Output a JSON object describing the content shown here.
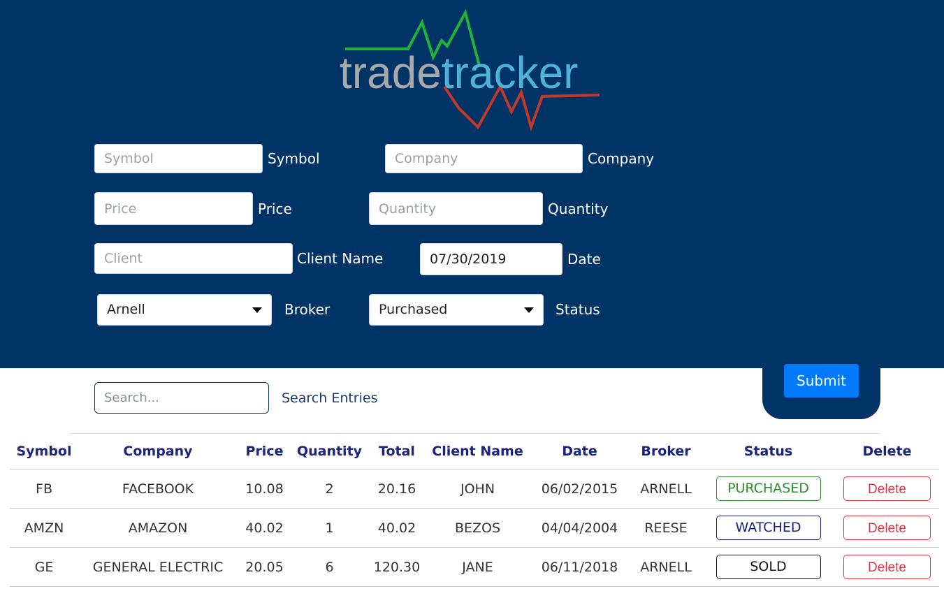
{
  "logo": {
    "part1": "trade",
    "part2": "tracker"
  },
  "form": {
    "symbol": {
      "placeholder": "Symbol",
      "label": "Symbol"
    },
    "company": {
      "placeholder": "Company",
      "label": "Company"
    },
    "price": {
      "placeholder": "Price",
      "label": "Price"
    },
    "quantity": {
      "placeholder": "Quantity",
      "label": "Quantity"
    },
    "client": {
      "placeholder": "Client",
      "label": "Client Name"
    },
    "date": {
      "value": "07/30/2019",
      "label": "Date"
    },
    "broker": {
      "value": "Arnell",
      "label": "Broker"
    },
    "status": {
      "value": "Purchased",
      "label": "Status"
    },
    "submit_label": "Submit"
  },
  "search": {
    "placeholder": "Search...",
    "label": "Search Entries"
  },
  "table": {
    "headers": [
      "Symbol",
      "Company",
      "Price",
      "Quantity",
      "Total",
      "Client Name",
      "Date",
      "Broker",
      "Status",
      "Delete"
    ],
    "rows": [
      {
        "symbol": "FB",
        "company": "FACEBOOK",
        "price": "10.08",
        "quantity": "2",
        "total": "20.16",
        "client": "JOHN",
        "date": "06/02/2015",
        "broker": "ARNELL",
        "status": "PURCHASED",
        "status_color": "#2e8b2e",
        "delete": "Delete"
      },
      {
        "symbol": "AMZN",
        "company": "AMAZON",
        "price": "40.02",
        "quantity": "1",
        "total": "40.02",
        "client": "BEZOS",
        "date": "04/04/2004",
        "broker": "REESE",
        "status": "WATCHED",
        "status_color": "#1a237e",
        "delete": "Delete"
      },
      {
        "symbol": "GE",
        "company": "GENERAL ELECTRIC",
        "price": "20.05",
        "quantity": "6",
        "total": "120.30",
        "client": "JANE",
        "date": "06/11/2018",
        "broker": "ARNELL",
        "status": "SOLD",
        "status_color": "#111111",
        "delete": "Delete"
      }
    ]
  },
  "colors": {
    "header_bg": "#003366",
    "accent": "#007bff",
    "logo_grey": "#a9a9a9",
    "logo_blue": "#4fb3d9",
    "line_green": "#1fb33a",
    "line_red": "#c0392b",
    "danger": "#dc3545"
  }
}
